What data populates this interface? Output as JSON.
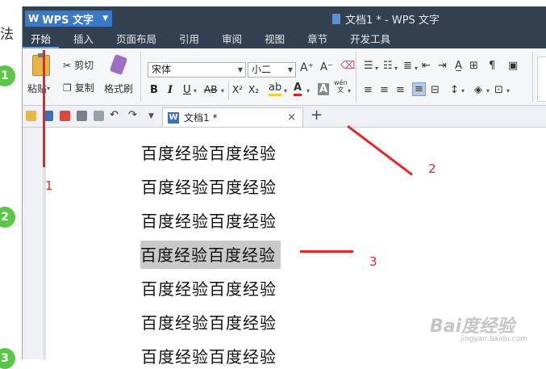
{
  "background": {
    "text": "法",
    "steps": [
      "1",
      "2",
      "3"
    ]
  },
  "app": {
    "name": "WPS 文字",
    "window_title": "文档1 * - WPS 文字"
  },
  "menu": {
    "items": [
      "开始",
      "插入",
      "页面布局",
      "引用",
      "审阅",
      "视图",
      "章节",
      "开发工具"
    ]
  },
  "ribbon": {
    "paste_label": "粘贴",
    "cut_label": "剪切",
    "copy_label": "复制",
    "format_painter_label": "格式刷",
    "font_name": "宋体",
    "font_size": "小二",
    "bold": "B",
    "italic": "I",
    "underline": "U",
    "strikethrough": "AB",
    "superscript": "X²",
    "subscript": "X₂",
    "grow_font": "A⁺",
    "shrink_font": "A⁻",
    "font_color": "A",
    "char_shading": "A",
    "pinyin_guide": "wén\n文"
  },
  "tabs": {
    "doc_tab": "文档1 *",
    "close": "×",
    "new": "+"
  },
  "document": {
    "lines": [
      "百度经验百度经验",
      "百度经验百度经验",
      "百度经验百度经验",
      "百度经验百度经验",
      "百度经验百度经验",
      "百度经验百度经验",
      "百度经验百度经验"
    ],
    "selected_line_index": 3
  },
  "annotations": {
    "labels": [
      "1",
      "2",
      "3"
    ],
    "color": "#e8232a"
  },
  "watermark": {
    "text": "Bai度经验",
    "subtext": "jingyan.baidu.com"
  },
  "colors": {
    "titlebar": "#33404f",
    "wps_button": "#3a78c8",
    "ribbon": "#f4f6f8",
    "selection": "#c9c9c9",
    "step_circle": "#5cc64a"
  }
}
